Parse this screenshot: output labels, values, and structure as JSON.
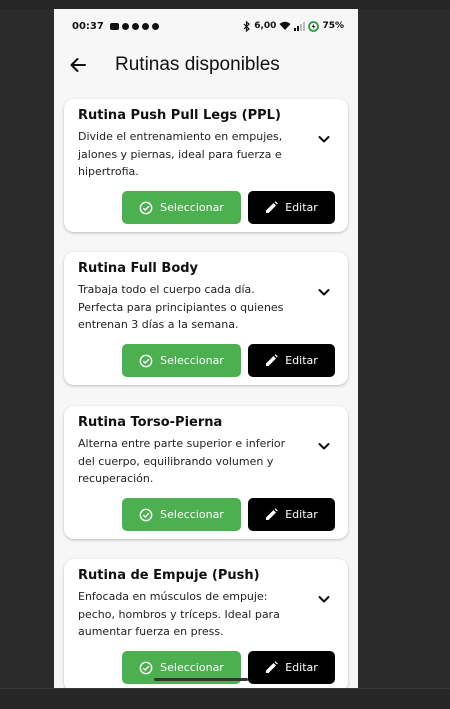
{
  "status_bar": {
    "time": "00:37",
    "network": "6,00",
    "battery": "75%"
  },
  "app_bar": {
    "title": "Rutinas disponibles"
  },
  "routines": [
    {
      "title": "Rutina Push Pull Legs (PPL)",
      "description": "Divide el entrenamiento en empujes, jalones y piernas, ideal para fuerza e hipertrofia.",
      "select_label": "Seleccionar",
      "edit_label": "Editar"
    },
    {
      "title": "Rutina Full Body",
      "description": "Trabaja todo el cuerpo cada día. Perfecta para principiantes o quienes entrenan 3 días a la semana.",
      "select_label": "Seleccionar",
      "edit_label": "Editar"
    },
    {
      "title": "Rutina Torso-Pierna",
      "description": "Alterna entre parte superior e inferior del cuerpo, equilibrando volumen y recuperación.",
      "select_label": "Seleccionar",
      "edit_label": "Editar"
    },
    {
      "title": "Rutina de Empuje (Push)",
      "description": "Enfocada en músculos de empuje: pecho, hombros y tríceps. Ideal para aumentar fuerza en press.",
      "select_label": "Seleccionar",
      "edit_label": "Editar"
    }
  ],
  "colors": {
    "select": "#4caf50",
    "edit": "#000000",
    "background": "#f7f7f7"
  },
  "icons": {
    "back": "arrow-back-icon",
    "expand": "chevron-down-icon",
    "select": "check-circle-icon",
    "edit": "pencil-icon"
  }
}
